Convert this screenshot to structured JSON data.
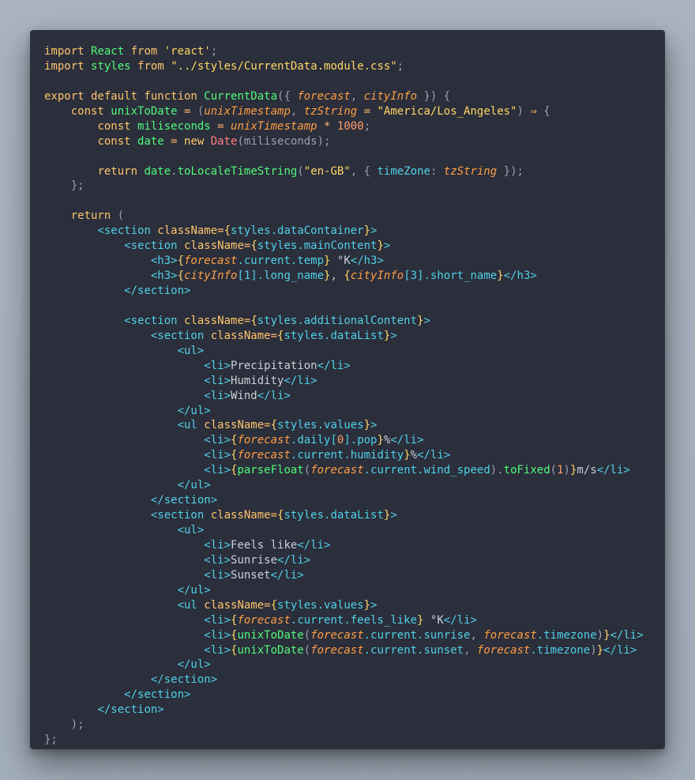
{
  "editor": {
    "lines": [
      [
        {
          "c": "kw",
          "t": "import "
        },
        {
          "c": "fn",
          "t": "React "
        },
        {
          "c": "kw",
          "t": "from "
        },
        {
          "c": "str",
          "t": "'react'"
        },
        {
          "c": "pun",
          "t": ";"
        }
      ],
      [
        {
          "c": "kw",
          "t": "import "
        },
        {
          "c": "fn",
          "t": "styles "
        },
        {
          "c": "kw",
          "t": "from "
        },
        {
          "c": "str",
          "t": "\"../styles/CurrentData.module.css\""
        },
        {
          "c": "pun",
          "t": ";"
        }
      ],
      [],
      [
        {
          "c": "kw",
          "t": "export default function "
        },
        {
          "c": "fn",
          "t": "CurrentData"
        },
        {
          "c": "pun",
          "t": "({ "
        },
        {
          "c": "prm",
          "t": "forecast"
        },
        {
          "c": "pun",
          "t": ", "
        },
        {
          "c": "prm",
          "t": "cityInfo"
        },
        {
          "c": "pun",
          "t": " }) {"
        }
      ],
      [
        {
          "c": "txt",
          "t": "    "
        },
        {
          "c": "kw",
          "t": "const "
        },
        {
          "c": "fn",
          "t": "unixToDate "
        },
        {
          "c": "op",
          "t": "= "
        },
        {
          "c": "pun",
          "t": "("
        },
        {
          "c": "prm",
          "t": "unixTimestamp"
        },
        {
          "c": "pun",
          "t": ", "
        },
        {
          "c": "prm",
          "t": "tzString"
        },
        {
          "c": "op",
          "t": " = "
        },
        {
          "c": "str",
          "t": "\"America/Los_Angeles\""
        },
        {
          "c": "pun",
          "t": ") "
        },
        {
          "c": "op",
          "t": "⇒ "
        },
        {
          "c": "pun",
          "t": "{"
        }
      ],
      [
        {
          "c": "txt",
          "t": "        "
        },
        {
          "c": "kw",
          "t": "const "
        },
        {
          "c": "fn",
          "t": "miliseconds "
        },
        {
          "c": "op",
          "t": "= "
        },
        {
          "c": "prm",
          "t": "unixTimestamp"
        },
        {
          "c": "op",
          "t": " * "
        },
        {
          "c": "num",
          "t": "1000"
        },
        {
          "c": "pun",
          "t": ";"
        }
      ],
      [
        {
          "c": "txt",
          "t": "        "
        },
        {
          "c": "kw",
          "t": "const "
        },
        {
          "c": "fn",
          "t": "date "
        },
        {
          "c": "op",
          "t": "= "
        },
        {
          "c": "kw",
          "t": "new "
        },
        {
          "c": "cls",
          "t": "Date"
        },
        {
          "c": "pun",
          "t": "(miliseconds);"
        }
      ],
      [],
      [
        {
          "c": "txt",
          "t": "        "
        },
        {
          "c": "kw",
          "t": "return "
        },
        {
          "c": "fn",
          "t": "date"
        },
        {
          "c": "pun",
          "t": "."
        },
        {
          "c": "fn",
          "t": "toLocaleTimeString"
        },
        {
          "c": "pun",
          "t": "("
        },
        {
          "c": "str",
          "t": "\"en-GB\""
        },
        {
          "c": "pun",
          "t": ", { "
        },
        {
          "c": "tag",
          "t": "timeZone"
        },
        {
          "c": "pun",
          "t": ": "
        },
        {
          "c": "prm",
          "t": "tzString"
        },
        {
          "c": "pun",
          "t": " });"
        }
      ],
      [
        {
          "c": "pun",
          "t": "    };"
        }
      ],
      [],
      [
        {
          "c": "txt",
          "t": "    "
        },
        {
          "c": "kw",
          "t": "return "
        },
        {
          "c": "pun",
          "t": "("
        }
      ],
      [
        {
          "c": "txt",
          "t": "        "
        },
        {
          "c": "tag",
          "t": "<section "
        },
        {
          "c": "kw",
          "t": "className"
        },
        {
          "c": "op",
          "t": "="
        },
        {
          "c": "br",
          "t": "{"
        },
        {
          "c": "tag",
          "t": "styles.dataContainer"
        },
        {
          "c": "br",
          "t": "}"
        },
        {
          "c": "tag",
          "t": ">"
        }
      ],
      [
        {
          "c": "txt",
          "t": "            "
        },
        {
          "c": "tag",
          "t": "<section "
        },
        {
          "c": "kw",
          "t": "className"
        },
        {
          "c": "op",
          "t": "="
        },
        {
          "c": "br",
          "t": "{"
        },
        {
          "c": "tag",
          "t": "styles.mainContent"
        },
        {
          "c": "br",
          "t": "}"
        },
        {
          "c": "tag",
          "t": ">"
        }
      ],
      [
        {
          "c": "txt",
          "t": "                "
        },
        {
          "c": "tag",
          "t": "<h3>"
        },
        {
          "c": "br",
          "t": "{"
        },
        {
          "c": "prm",
          "t": "forecast"
        },
        {
          "c": "tag",
          "t": ".current.temp"
        },
        {
          "c": "br",
          "t": "}"
        },
        {
          "c": "txt",
          "t": " °K"
        },
        {
          "c": "tag",
          "t": "</h3>"
        }
      ],
      [
        {
          "c": "txt",
          "t": "                "
        },
        {
          "c": "tag",
          "t": "<h3>"
        },
        {
          "c": "br",
          "t": "{"
        },
        {
          "c": "prm",
          "t": "cityInfo"
        },
        {
          "c": "tag",
          "t": "[1].long_name"
        },
        {
          "c": "br",
          "t": "}"
        },
        {
          "c": "txt",
          "t": ", "
        },
        {
          "c": "br",
          "t": "{"
        },
        {
          "c": "prm",
          "t": "cityInfo"
        },
        {
          "c": "tag",
          "t": "[3].short_name"
        },
        {
          "c": "br",
          "t": "}"
        },
        {
          "c": "tag",
          "t": "</h3>"
        }
      ],
      [
        {
          "c": "txt",
          "t": "            "
        },
        {
          "c": "tag",
          "t": "</section>"
        }
      ],
      [],
      [
        {
          "c": "txt",
          "t": "            "
        },
        {
          "c": "tag",
          "t": "<section "
        },
        {
          "c": "kw",
          "t": "className"
        },
        {
          "c": "op",
          "t": "="
        },
        {
          "c": "br",
          "t": "{"
        },
        {
          "c": "tag",
          "t": "styles.additionalContent"
        },
        {
          "c": "br",
          "t": "}"
        },
        {
          "c": "tag",
          "t": ">"
        }
      ],
      [
        {
          "c": "txt",
          "t": "                "
        },
        {
          "c": "tag",
          "t": "<section "
        },
        {
          "c": "kw",
          "t": "className"
        },
        {
          "c": "op",
          "t": "="
        },
        {
          "c": "br",
          "t": "{"
        },
        {
          "c": "tag",
          "t": "styles.dataList"
        },
        {
          "c": "br",
          "t": "}"
        },
        {
          "c": "tag",
          "t": ">"
        }
      ],
      [
        {
          "c": "txt",
          "t": "                    "
        },
        {
          "c": "tag",
          "t": "<ul>"
        }
      ],
      [
        {
          "c": "txt",
          "t": "                        "
        },
        {
          "c": "tag",
          "t": "<li>"
        },
        {
          "c": "txt",
          "t": "Precipitation"
        },
        {
          "c": "tag",
          "t": "</li>"
        }
      ],
      [
        {
          "c": "txt",
          "t": "                        "
        },
        {
          "c": "tag",
          "t": "<li>"
        },
        {
          "c": "txt",
          "t": "Humidity"
        },
        {
          "c": "tag",
          "t": "</li>"
        }
      ],
      [
        {
          "c": "txt",
          "t": "                        "
        },
        {
          "c": "tag",
          "t": "<li>"
        },
        {
          "c": "txt",
          "t": "Wind"
        },
        {
          "c": "tag",
          "t": "</li>"
        }
      ],
      [
        {
          "c": "txt",
          "t": "                    "
        },
        {
          "c": "tag",
          "t": "</ul>"
        }
      ],
      [
        {
          "c": "txt",
          "t": "                    "
        },
        {
          "c": "tag",
          "t": "<ul "
        },
        {
          "c": "kw",
          "t": "className"
        },
        {
          "c": "op",
          "t": "="
        },
        {
          "c": "br",
          "t": "{"
        },
        {
          "c": "tag",
          "t": "styles.values"
        },
        {
          "c": "br",
          "t": "}"
        },
        {
          "c": "tag",
          "t": ">"
        }
      ],
      [
        {
          "c": "txt",
          "t": "                        "
        },
        {
          "c": "tag",
          "t": "<li>"
        },
        {
          "c": "br",
          "t": "{"
        },
        {
          "c": "prm",
          "t": "forecast"
        },
        {
          "c": "tag",
          "t": ".daily["
        },
        {
          "c": "num",
          "t": "0"
        },
        {
          "c": "tag",
          "t": "].pop"
        },
        {
          "c": "br",
          "t": "}"
        },
        {
          "c": "txt",
          "t": "%"
        },
        {
          "c": "tag",
          "t": "</li>"
        }
      ],
      [
        {
          "c": "txt",
          "t": "                        "
        },
        {
          "c": "tag",
          "t": "<li>"
        },
        {
          "c": "br",
          "t": "{"
        },
        {
          "c": "prm",
          "t": "forecast"
        },
        {
          "c": "tag",
          "t": ".current.humidity"
        },
        {
          "c": "br",
          "t": "}"
        },
        {
          "c": "txt",
          "t": "%"
        },
        {
          "c": "tag",
          "t": "</li>"
        }
      ],
      [
        {
          "c": "txt",
          "t": "                        "
        },
        {
          "c": "tag",
          "t": "<li>"
        },
        {
          "c": "br",
          "t": "{"
        },
        {
          "c": "fn",
          "t": "parseFloat"
        },
        {
          "c": "pun",
          "t": "("
        },
        {
          "c": "prm",
          "t": "forecast"
        },
        {
          "c": "tag",
          "t": ".current.wind_speed"
        },
        {
          "c": "pun",
          "t": ")."
        },
        {
          "c": "fn",
          "t": "toFixed"
        },
        {
          "c": "pun",
          "t": "("
        },
        {
          "c": "num",
          "t": "1"
        },
        {
          "c": "pun",
          "t": ")"
        },
        {
          "c": "br",
          "t": "}"
        },
        {
          "c": "txt",
          "t": "m/s"
        },
        {
          "c": "tag",
          "t": "</li>"
        }
      ],
      [
        {
          "c": "txt",
          "t": "                    "
        },
        {
          "c": "tag",
          "t": "</ul>"
        }
      ],
      [
        {
          "c": "txt",
          "t": "                "
        },
        {
          "c": "tag",
          "t": "</section>"
        }
      ],
      [
        {
          "c": "txt",
          "t": "                "
        },
        {
          "c": "tag",
          "t": "<section "
        },
        {
          "c": "kw",
          "t": "className"
        },
        {
          "c": "op",
          "t": "="
        },
        {
          "c": "br",
          "t": "{"
        },
        {
          "c": "tag",
          "t": "styles.dataList"
        },
        {
          "c": "br",
          "t": "}"
        },
        {
          "c": "tag",
          "t": ">"
        }
      ],
      [
        {
          "c": "txt",
          "t": "                    "
        },
        {
          "c": "tag",
          "t": "<ul>"
        }
      ],
      [
        {
          "c": "txt",
          "t": "                        "
        },
        {
          "c": "tag",
          "t": "<li>"
        },
        {
          "c": "txt",
          "t": "Feels like"
        },
        {
          "c": "tag",
          "t": "</li>"
        }
      ],
      [
        {
          "c": "txt",
          "t": "                        "
        },
        {
          "c": "tag",
          "t": "<li>"
        },
        {
          "c": "txt",
          "t": "Sunrise"
        },
        {
          "c": "tag",
          "t": "</li>"
        }
      ],
      [
        {
          "c": "txt",
          "t": "                        "
        },
        {
          "c": "tag",
          "t": "<li>"
        },
        {
          "c": "txt",
          "t": "Sunset"
        },
        {
          "c": "tag",
          "t": "</li>"
        }
      ],
      [
        {
          "c": "txt",
          "t": "                    "
        },
        {
          "c": "tag",
          "t": "</ul>"
        }
      ],
      [
        {
          "c": "txt",
          "t": "                    "
        },
        {
          "c": "tag",
          "t": "<ul "
        },
        {
          "c": "kw",
          "t": "className"
        },
        {
          "c": "op",
          "t": "="
        },
        {
          "c": "br",
          "t": "{"
        },
        {
          "c": "tag",
          "t": "styles.values"
        },
        {
          "c": "br",
          "t": "}"
        },
        {
          "c": "tag",
          "t": ">"
        }
      ],
      [
        {
          "c": "txt",
          "t": "                        "
        },
        {
          "c": "tag",
          "t": "<li>"
        },
        {
          "c": "br",
          "t": "{"
        },
        {
          "c": "prm",
          "t": "forecast"
        },
        {
          "c": "tag",
          "t": ".current.feels_like"
        },
        {
          "c": "br",
          "t": "}"
        },
        {
          "c": "txt",
          "t": " °K"
        },
        {
          "c": "tag",
          "t": "</li>"
        }
      ],
      [
        {
          "c": "txt",
          "t": "                        "
        },
        {
          "c": "tag",
          "t": "<li>"
        },
        {
          "c": "br",
          "t": "{"
        },
        {
          "c": "fn",
          "t": "unixToDate"
        },
        {
          "c": "pun",
          "t": "("
        },
        {
          "c": "prm",
          "t": "forecast"
        },
        {
          "c": "tag",
          "t": ".current.sunrise"
        },
        {
          "c": "pun",
          "t": ", "
        },
        {
          "c": "prm",
          "t": "forecast"
        },
        {
          "c": "tag",
          "t": ".timezone"
        },
        {
          "c": "pun",
          "t": ")"
        },
        {
          "c": "br",
          "t": "}"
        },
        {
          "c": "tag",
          "t": "</li>"
        }
      ],
      [
        {
          "c": "txt",
          "t": "                        "
        },
        {
          "c": "tag",
          "t": "<li>"
        },
        {
          "c": "br",
          "t": "{"
        },
        {
          "c": "fn",
          "t": "unixToDate"
        },
        {
          "c": "pun",
          "t": "("
        },
        {
          "c": "prm",
          "t": "forecast"
        },
        {
          "c": "tag",
          "t": ".current.sunset"
        },
        {
          "c": "pun",
          "t": ", "
        },
        {
          "c": "prm",
          "t": "forecast"
        },
        {
          "c": "tag",
          "t": ".timezone"
        },
        {
          "c": "pun",
          "t": ")"
        },
        {
          "c": "br",
          "t": "}"
        },
        {
          "c": "tag",
          "t": "</li>"
        }
      ],
      [
        {
          "c": "txt",
          "t": "                    "
        },
        {
          "c": "tag",
          "t": "</ul>"
        }
      ],
      [
        {
          "c": "txt",
          "t": "                "
        },
        {
          "c": "tag",
          "t": "</section>"
        }
      ],
      [
        {
          "c": "txt",
          "t": "            "
        },
        {
          "c": "tag",
          "t": "</section>"
        }
      ],
      [
        {
          "c": "txt",
          "t": "        "
        },
        {
          "c": "tag",
          "t": "</section>"
        }
      ],
      [
        {
          "c": "pun",
          "t": "    );"
        }
      ],
      [
        {
          "c": "pun",
          "t": "};"
        }
      ]
    ]
  }
}
